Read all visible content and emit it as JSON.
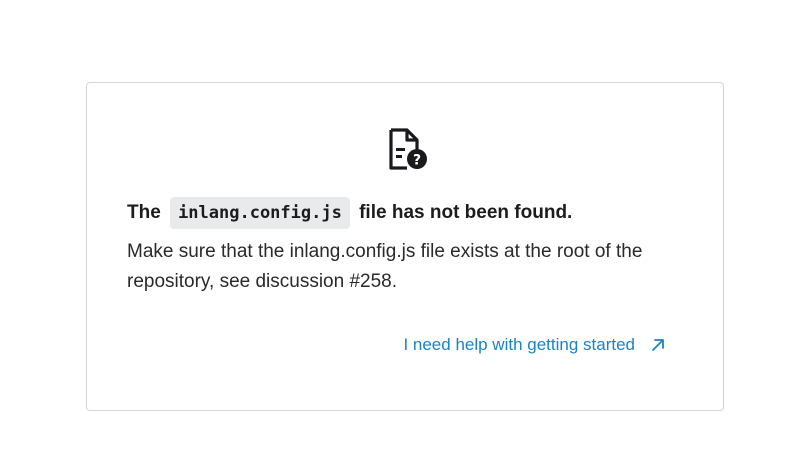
{
  "notice": {
    "title_prefix": "The",
    "file_name": "inlang.config.js",
    "title_suffix": "file has not been found.",
    "description": "Make sure that the inlang.config.js file exists at the root of the repository, see discussion #258.",
    "help_link": "I need help with getting started",
    "icons": {
      "main": "file-question-icon",
      "link": "arrow-up-right-icon"
    },
    "colors": {
      "link": "#1b84c6",
      "code_bg": "#e9eaec",
      "border": "#d4d6da"
    }
  }
}
